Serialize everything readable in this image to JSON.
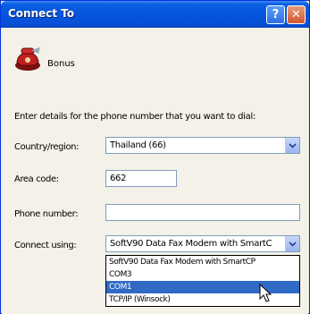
{
  "window": {
    "title": "Connect To",
    "help_label": "?",
    "close_label": "✕"
  },
  "connection": {
    "name": "Bonus"
  },
  "instruction": "Enter details for the phone number that you want to dial:",
  "form": {
    "country_label": "Country/region:",
    "country_value": "Thailand (66)",
    "area_label": "Area code:",
    "area_value": "662",
    "phone_label": "Phone number:",
    "phone_value": "",
    "connect_label": "Connect using:",
    "connect_value": "SoftV90 Data Fax Modem with SmartC"
  },
  "dropdown": {
    "options": [
      "SoftV90 Data Fax Modem with SmartCP",
      "COM3",
      "COM1",
      "TCP/IP (Winsock)"
    ],
    "selected_index": 2
  },
  "colors": {
    "titlebar": "#0555de",
    "selection": "#316ac5",
    "field_border": "#7f9db9"
  }
}
